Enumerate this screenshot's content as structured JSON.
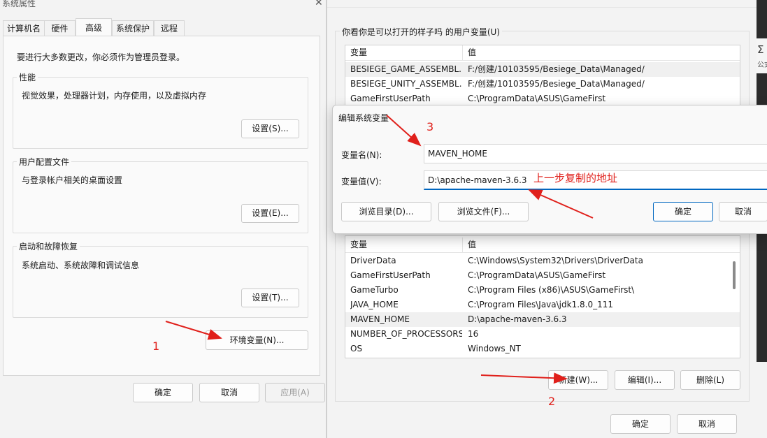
{
  "sysprops": {
    "title": "系统属性",
    "tabs": [
      "计算机名",
      "硬件",
      "高级",
      "系统保护",
      "远程"
    ],
    "admin_note": "要进行大多数更改，你必须作为管理员登录。",
    "performance": {
      "title": "性能",
      "desc": "视觉效果，处理器计划，内存使用，以及虚拟内存",
      "button": "设置(S)..."
    },
    "profiles": {
      "title": "用户配置文件",
      "desc": "与登录帐户相关的桌面设置",
      "button": "设置(E)..."
    },
    "startup": {
      "title": "启动和故障恢复",
      "desc": "系统启动、系统故障和调试信息",
      "button": "设置(T)..."
    },
    "env_button": "环境变量(N)...",
    "ok": "确定",
    "cancel": "取消",
    "apply": "应用(A)"
  },
  "envvars": {
    "user_group_title": "你看你是可以打开的样子吗 的用户变量(U)",
    "col_var": "变量",
    "col_val": "值",
    "user_rows": [
      {
        "name": "BESIEGE_GAME_ASSEMBL...",
        "value": "F:/创建/10103595/Besiege_Data\\Managed/"
      },
      {
        "name": "BESIEGE_UNITY_ASSEMBL...",
        "value": "F:/创建/10103595/Besiege_Data\\Managed/"
      },
      {
        "name": "GameFirstUserPath",
        "value": "C:\\ProgramData\\ASUS\\GameFirst"
      }
    ],
    "sys_rows": [
      {
        "name": "DriverData",
        "value": "C:\\Windows\\System32\\Drivers\\DriverData"
      },
      {
        "name": "GameFirstUserPath",
        "value": "C:\\ProgramData\\ASUS\\GameFirst"
      },
      {
        "name": "GameTurbo",
        "value": "C:\\Program Files (x86)\\ASUS\\GameFirst\\"
      },
      {
        "name": "JAVA_HOME",
        "value": "C:\\Program Files\\Java\\jdk1.8.0_111"
      },
      {
        "name": "MAVEN_HOME",
        "value": "D:\\apache-maven-3.6.3"
      },
      {
        "name": "NUMBER_OF_PROCESSORS",
        "value": "16"
      },
      {
        "name": "OS",
        "value": "Windows_NT"
      }
    ],
    "new_button": "新建(W)...",
    "edit_button": "编辑(I)...",
    "delete_button": "删除(L)",
    "ok": "确定",
    "cancel": "取消"
  },
  "editdlg": {
    "title": "编辑系统变量",
    "name_label": "变量名(N):",
    "name_value": "MAVEN_HOME",
    "value_label": "变量值(V):",
    "value_value": "D:\\apache-maven-3.6.3",
    "browse_dir": "浏览目录(D)...",
    "browse_file": "浏览文件(F)...",
    "ok": "确定",
    "cancel": "取消"
  },
  "annotations": {
    "step1": "1",
    "step2": "2",
    "step3": "3",
    "note": "上一步复制的地址",
    "color": "#e0201b"
  },
  "edge_glyph": "Σ",
  "edge_text": "公式"
}
